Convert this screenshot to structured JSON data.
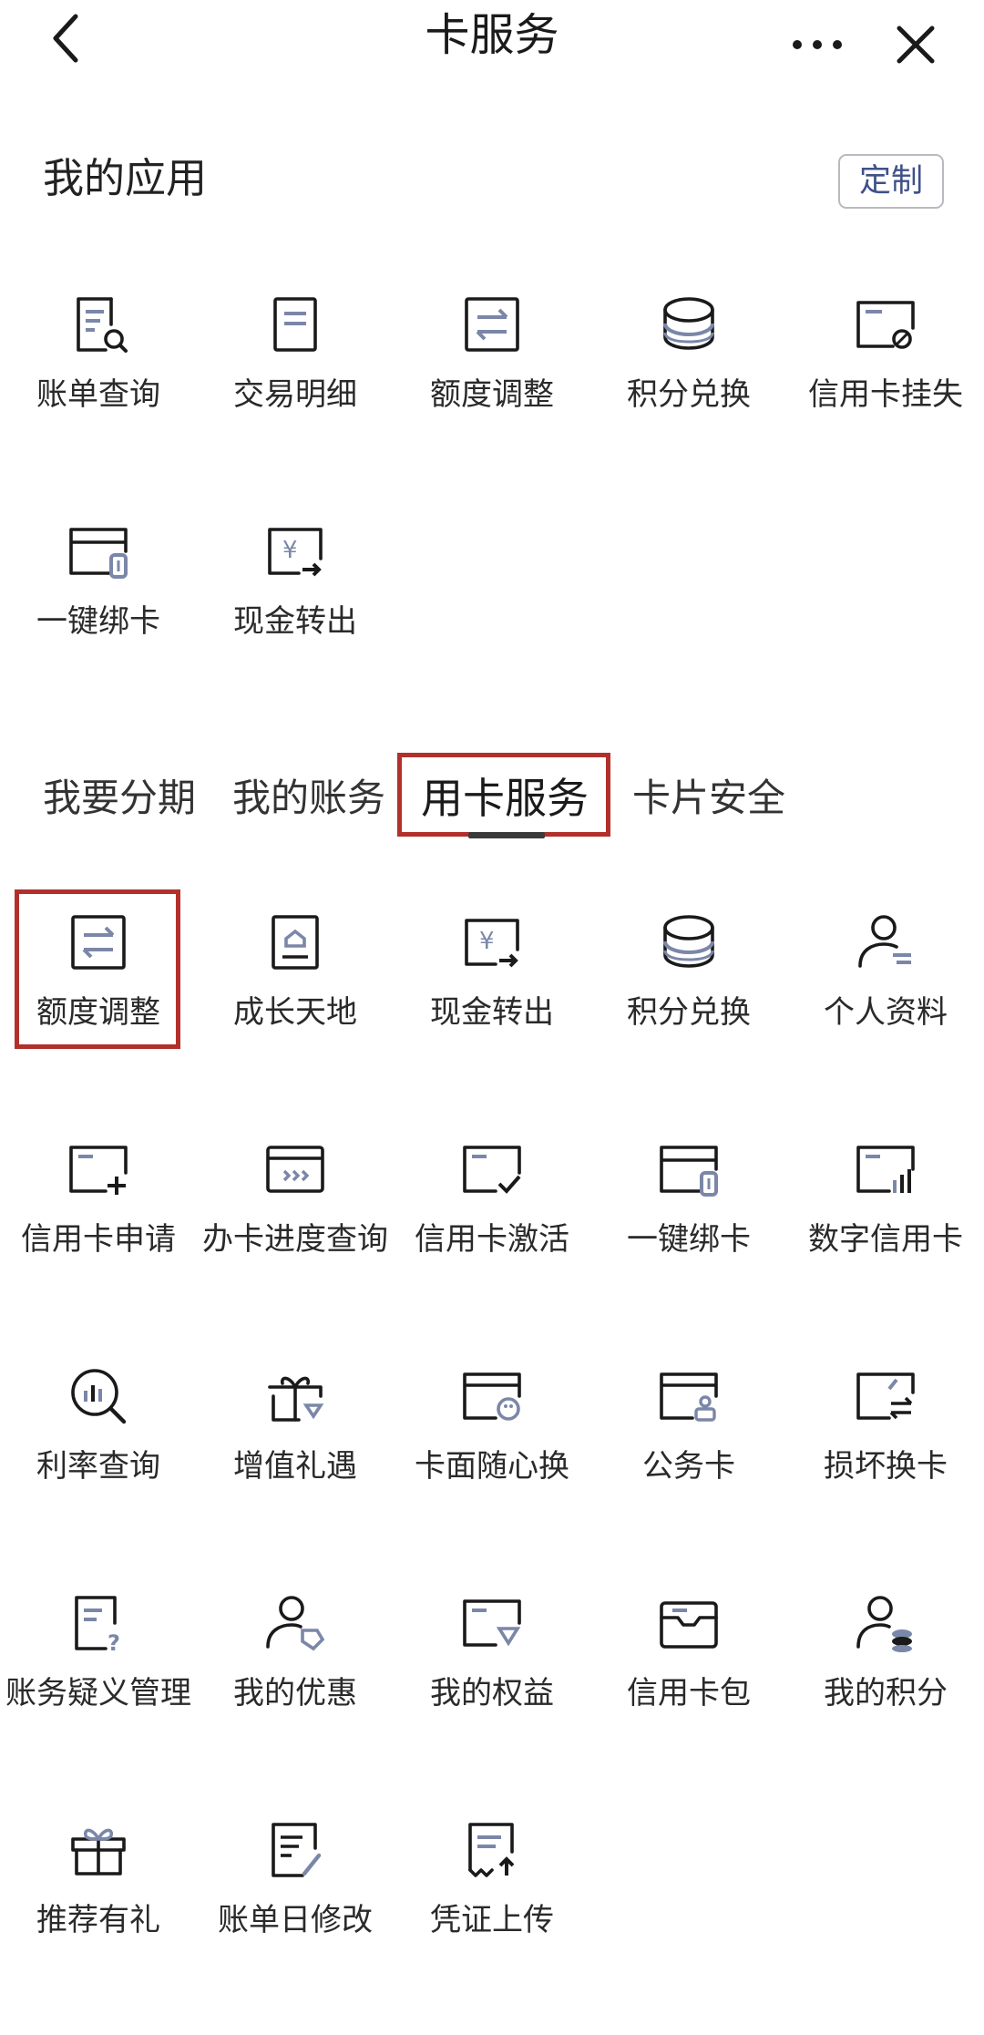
{
  "header": {
    "title": "卡服务",
    "back_icon": "back-arrow-icon",
    "more_icon": "more-icon",
    "close_icon": "close-icon"
  },
  "my_apps": {
    "title": "我的应用",
    "customize_label": "定制",
    "items": [
      {
        "label": "账单查询",
        "icon": "bill-search-icon"
      },
      {
        "label": "交易明细",
        "icon": "document-icon"
      },
      {
        "label": "额度调整",
        "icon": "transfer-icon"
      },
      {
        "label": "积分兑换",
        "icon": "coins-icon"
      },
      {
        "label": "信用卡挂失",
        "icon": "card-lock-icon"
      },
      {
        "label": "一键绑卡",
        "icon": "card-link-icon"
      },
      {
        "label": "现金转出",
        "icon": "cash-out-icon"
      }
    ]
  },
  "tabs": [
    {
      "label": "我要分期"
    },
    {
      "label": "我的账务"
    },
    {
      "label": "用卡服务"
    },
    {
      "label": "卡片安全"
    }
  ],
  "active_tab": "用卡服务",
  "services": {
    "items": [
      {
        "label": "额度调整",
        "icon": "transfer-icon"
      },
      {
        "label": "成长天地",
        "icon": "growth-icon"
      },
      {
        "label": "现金转出",
        "icon": "cash-out-icon"
      },
      {
        "label": "积分兑换",
        "icon": "coins-icon"
      },
      {
        "label": "个人资料",
        "icon": "user-profile-icon"
      },
      {
        "label": "信用卡申请",
        "icon": "card-add-icon"
      },
      {
        "label": "办卡进度查询",
        "icon": "progress-card-icon"
      },
      {
        "label": "信用卡激活",
        "icon": "card-check-icon"
      },
      {
        "label": "一键绑卡",
        "icon": "card-link-icon"
      },
      {
        "label": "数字信用卡",
        "icon": "digital-card-icon"
      },
      {
        "label": "利率查询",
        "icon": "rate-search-icon"
      },
      {
        "label": "增值礼遇",
        "icon": "gift-diamond-icon"
      },
      {
        "label": "卡面随心换",
        "icon": "card-palette-icon"
      },
      {
        "label": "公务卡",
        "icon": "business-card-icon"
      },
      {
        "label": "损坏换卡",
        "icon": "card-exchange-icon"
      },
      {
        "label": "账务疑义管理",
        "icon": "doc-question-icon"
      },
      {
        "label": "我的优惠",
        "icon": "user-tag-icon"
      },
      {
        "label": "我的权益",
        "icon": "card-diamond-icon"
      },
      {
        "label": "信用卡包",
        "icon": "wallet-icon"
      },
      {
        "label": "我的积分",
        "icon": "user-coins-icon"
      },
      {
        "label": "推荐有礼",
        "icon": "gift-icon"
      },
      {
        "label": "账单日修改",
        "icon": "doc-edit-icon"
      },
      {
        "label": "凭证上传",
        "icon": "receipt-upload-icon"
      }
    ]
  },
  "colors": {
    "icon_stroke": "#1a1a1a",
    "icon_accent": "#7b87a8",
    "highlight": "#b2302b",
    "button_text": "#3f5189"
  }
}
